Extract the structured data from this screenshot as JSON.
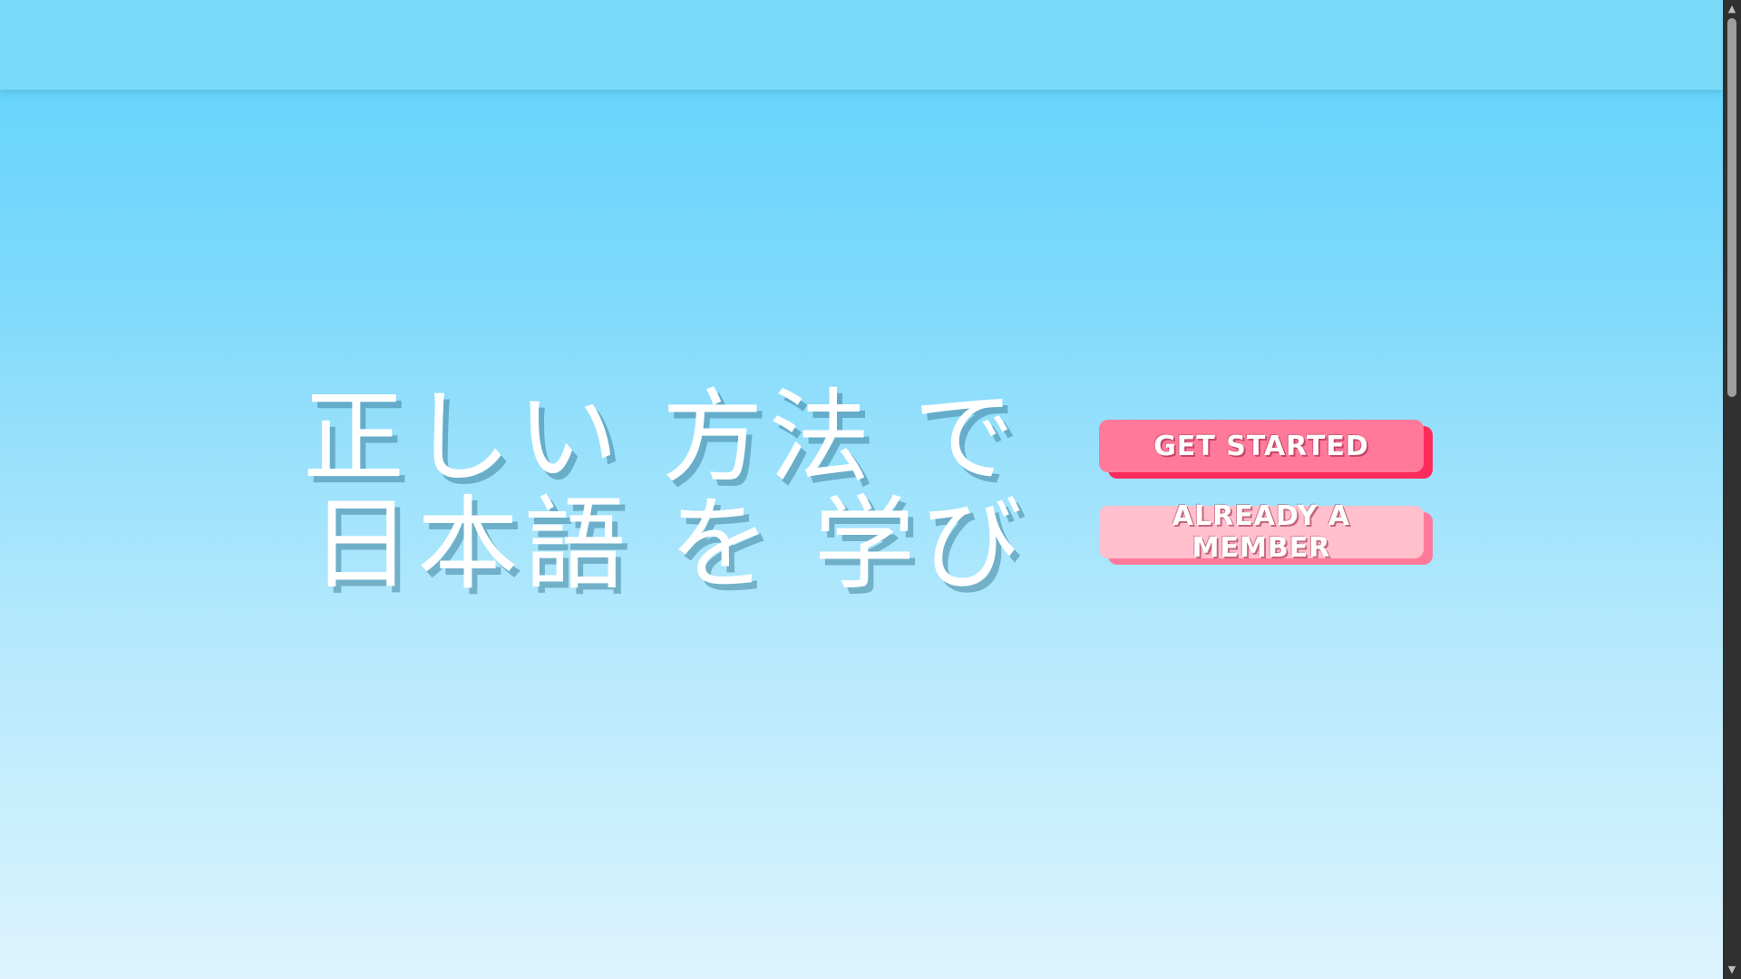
{
  "hero": {
    "line1": "正しい 方法 で",
    "line2": "日本語 を 学び"
  },
  "actions": {
    "get_started_label": "Get Started",
    "already_member_label": "Already a Member"
  },
  "colors": {
    "background_top": "#5dd3fb",
    "background_bottom": "#ddf4fe",
    "header_bar": "#7ad9f6",
    "primary_button": "#ff7a9a",
    "primary_button_shadow": "#ff2a5c",
    "secondary_button": "#ffbfcc",
    "secondary_button_shadow": "#ff7a9a",
    "scrollbar_track": "#303030",
    "scrollbar_thumb": "#9e9e9e"
  },
  "icons": {
    "scroll_up": "scroll-up-arrow-icon",
    "scroll_down": "scroll-down-arrow-icon"
  }
}
